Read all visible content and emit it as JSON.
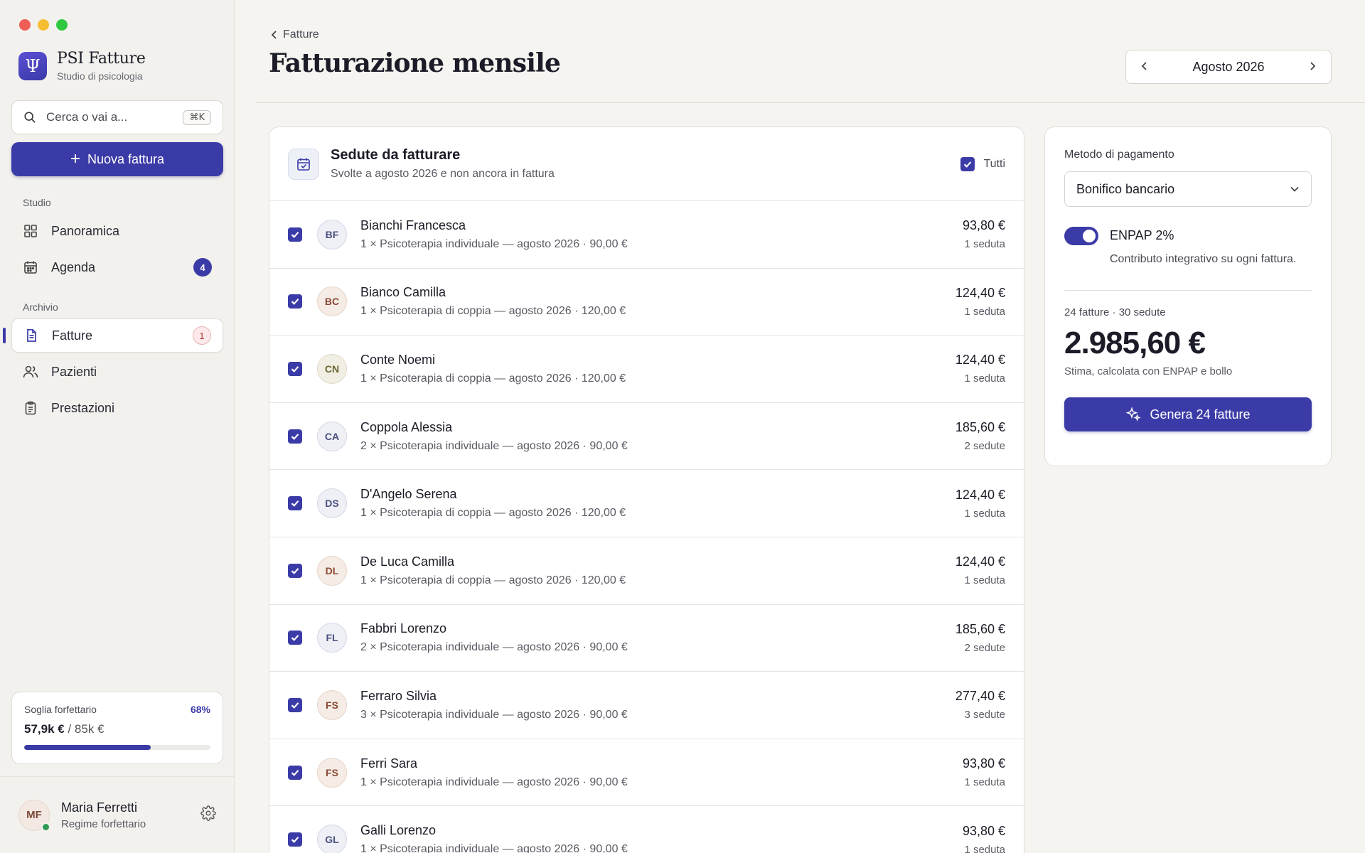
{
  "app": {
    "name": "PSI Fatture",
    "subtitle": "Studio di psicologia",
    "logo_glyph": "Ψ"
  },
  "search": {
    "placeholder": "Cerca o vai a...",
    "shortcut": "⌘K"
  },
  "new_invoice": {
    "label": "Nuova fattura"
  },
  "sidebar": {
    "section_studio": "Studio",
    "section_archivio": "Archivio",
    "items": [
      {
        "label": "Panoramica",
        "icon": "grid-icon"
      },
      {
        "label": "Agenda",
        "icon": "calendar-icon",
        "badge": "4"
      },
      {
        "label": "Fatture",
        "icon": "document-icon",
        "badge": "1",
        "active": true
      },
      {
        "label": "Pazienti",
        "icon": "users-icon"
      },
      {
        "label": "Prestazioni",
        "icon": "clipboard-icon"
      }
    ]
  },
  "threshold": {
    "label": "Soglia forfettario",
    "percent": "68%",
    "progress": 0.68,
    "amount": "57,9k €",
    "limit": "/ 85k €"
  },
  "user": {
    "initials": "MF",
    "name": "Maria Ferretti",
    "regime": "Regime forfettario"
  },
  "header": {
    "breadcrumb": "Fatture",
    "title": "Fatturazione mensile",
    "month": "Agosto 2026"
  },
  "list": {
    "title": "Sedute da fatturare",
    "subtitle": "Svolte a agosto 2026 e non ancora in fattura",
    "select_all": "Tutti",
    "rows": [
      {
        "initials": "BF",
        "name": "Bianchi Francesca",
        "desc": "1 × Psicoterapia individuale — agosto 2026 · 90,00 €",
        "amount": "93,80 €",
        "count": "1 seduta",
        "tone": "cool"
      },
      {
        "initials": "BC",
        "name": "Bianco Camilla",
        "desc": "1 × Psicoterapia di coppia — agosto 2026 · 120,00 €",
        "amount": "124,40 €",
        "count": "1 seduta",
        "tone": "warm"
      },
      {
        "initials": "CN",
        "name": "Conte Noemi",
        "desc": "1 × Psicoterapia di coppia — agosto 2026 · 120,00 €",
        "amount": "124,40 €",
        "count": "1 seduta",
        "tone": "olive"
      },
      {
        "initials": "CA",
        "name": "Coppola Alessia",
        "desc": "2 × Psicoterapia individuale — agosto 2026 · 90,00 €",
        "amount": "185,60 €",
        "count": "2 sedute",
        "tone": "cool"
      },
      {
        "initials": "DS",
        "name": "D'Angelo Serena",
        "desc": "1 × Psicoterapia di coppia — agosto 2026 · 120,00 €",
        "amount": "124,40 €",
        "count": "1 seduta",
        "tone": "cool"
      },
      {
        "initials": "DL",
        "name": "De Luca Camilla",
        "desc": "1 × Psicoterapia di coppia — agosto 2026 · 120,00 €",
        "amount": "124,40 €",
        "count": "1 seduta",
        "tone": "warm"
      },
      {
        "initials": "FL",
        "name": "Fabbri Lorenzo",
        "desc": "2 × Psicoterapia individuale — agosto 2026 · 90,00 €",
        "amount": "185,60 €",
        "count": "2 sedute",
        "tone": "cool"
      },
      {
        "initials": "FS",
        "name": "Ferraro Silvia",
        "desc": "3 × Psicoterapia individuale — agosto 2026 · 90,00 €",
        "amount": "277,40 €",
        "count": "3 sedute",
        "tone": "warm"
      },
      {
        "initials": "FS",
        "name": "Ferri Sara",
        "desc": "1 × Psicoterapia individuale — agosto 2026 · 90,00 €",
        "amount": "93,80 €",
        "count": "1 seduta",
        "tone": "warm"
      },
      {
        "initials": "GL",
        "name": "Galli Lorenzo",
        "desc": "1 × Psicoterapia individuale — agosto 2026 · 90,00 €",
        "amount": "93,80 €",
        "count": "1 seduta",
        "tone": "cool"
      }
    ]
  },
  "summary": {
    "payment_label": "Metodo di pagamento",
    "payment_value": "Bonifico bancario",
    "enpap_title": "ENPAP 2%",
    "enpap_desc": "Contributo integrativo su ogni fattura.",
    "counts": "24 fatture · 30 sedute",
    "total": "2.985,60 €",
    "note": "Stima, calcolata con ENPAP e bollo",
    "generate_label": "Genera 24 fatture"
  },
  "colors": {
    "accent": "#3b3ba8",
    "background": "#f6f4f0"
  }
}
